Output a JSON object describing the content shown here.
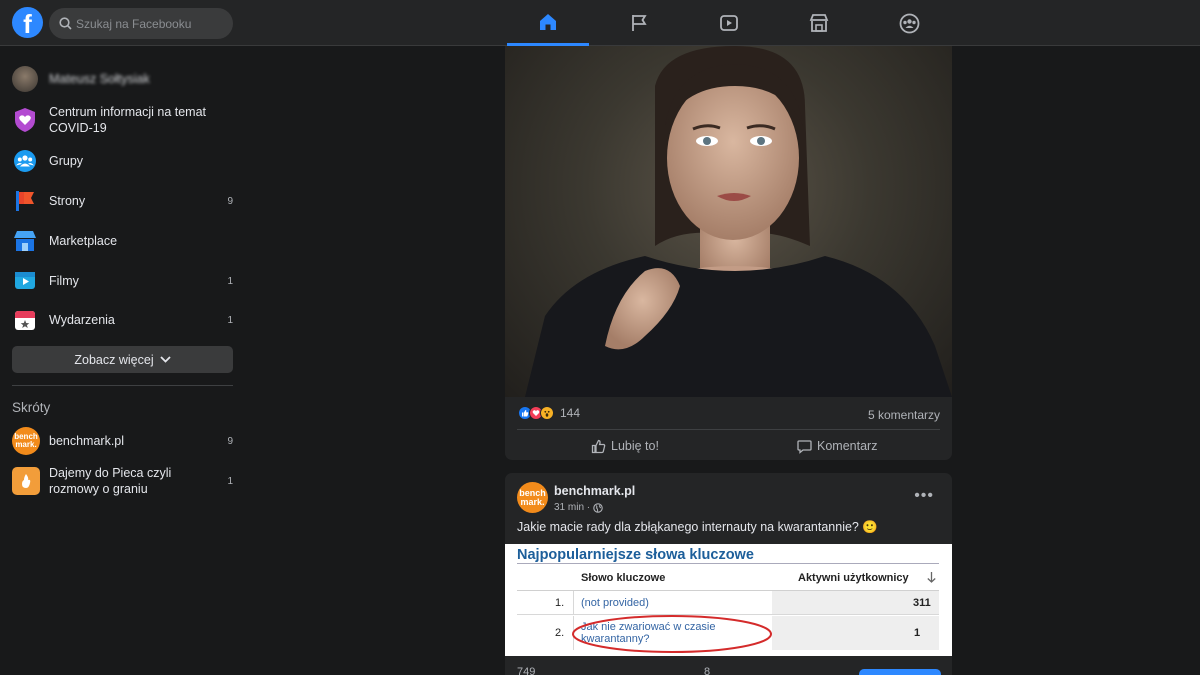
{
  "search": {
    "placeholder": "Szukaj na Facebooku"
  },
  "nav": [
    {
      "icon": "home-icon",
      "active": true
    },
    {
      "icon": "flag-icon",
      "active": false
    },
    {
      "icon": "watch-icon",
      "active": false
    },
    {
      "icon": "marketplace-icon",
      "active": false
    },
    {
      "icon": "groups-icon",
      "active": false
    }
  ],
  "sidebar": {
    "profile_name": "Mateusz Sołtysiak",
    "items": [
      {
        "label": "Centrum informacji na temat COVID-19",
        "icon": "covid-heart-icon",
        "count": ""
      },
      {
        "label": "Grupy",
        "icon": "groups-icon",
        "count": ""
      },
      {
        "label": "Strony",
        "icon": "flag-icon",
        "count": "9"
      },
      {
        "label": "Marketplace",
        "icon": "shop-icon",
        "count": ""
      },
      {
        "label": "Filmy",
        "icon": "video-icon",
        "count": "1"
      },
      {
        "label": "Wydarzenia",
        "icon": "calendar-icon",
        "count": "1"
      }
    ],
    "see_more": "Zobacz więcej",
    "shortcuts_title": "Skróty",
    "shortcuts": [
      {
        "label": "benchmark.pl",
        "count": "9"
      },
      {
        "label": "Dajemy do Pieca czyli rozmowy o graniu",
        "count": "1"
      }
    ]
  },
  "post1": {
    "reaction_count": "144",
    "comments": "5 komentarzy",
    "like_label": "Lubię to!",
    "comment_label": "Komentarz"
  },
  "post2": {
    "author": "benchmark.pl",
    "time": "31 min ·",
    "text": "Jakie macie rady dla zbłąkanego internauty na kwarantannie? 🙂",
    "avatar_text_1": "bench",
    "avatar_text_2": "mark.",
    "table": {
      "title": "Najpopularniejsze słowa kluczowe",
      "col1": "Słowo kluczowe",
      "col2": "Aktywni użytkownicy",
      "rows": [
        {
          "num": "1.",
          "keyword": "(not provided)",
          "users": "311"
        },
        {
          "num": "2.",
          "keyword": "Jak nie zwariować w czasie kwarantanny?",
          "users": "1"
        }
      ]
    },
    "footer_left": "749",
    "footer_mid": "8"
  },
  "colors": {
    "accent": "#2d88ff",
    "background": "#18191a",
    "card": "#242526"
  }
}
